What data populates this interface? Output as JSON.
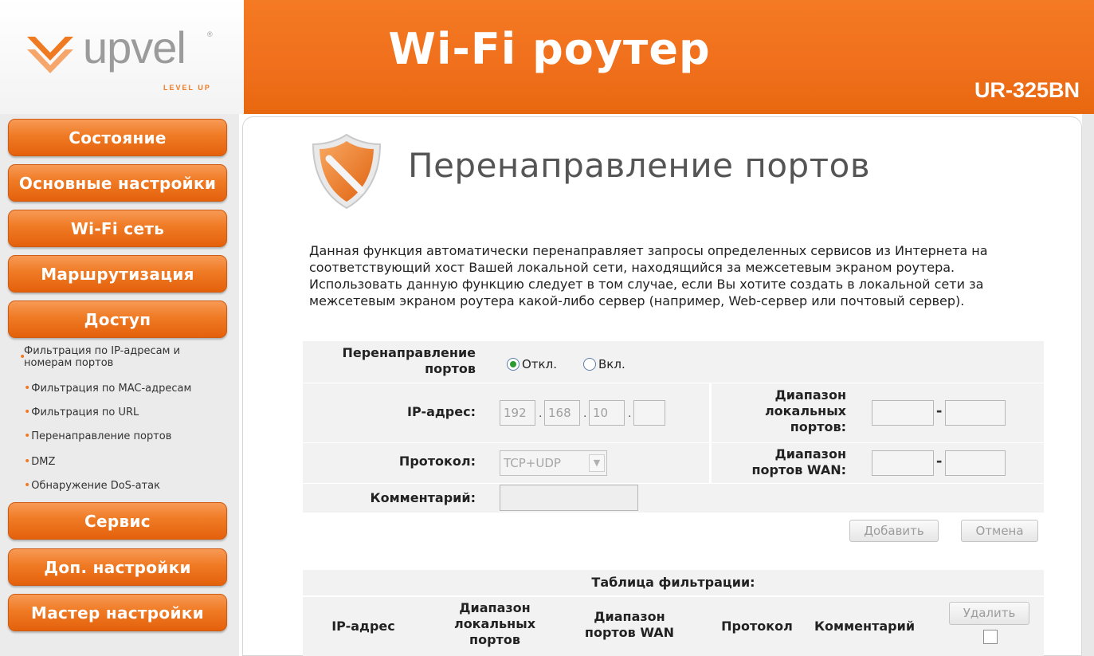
{
  "header": {
    "logo_word": "upvel",
    "logo_tagline": "LEVEL UP",
    "logo_registered": "®",
    "title": "Wi-Fi роутер",
    "model": "UR-325BN",
    "brand_color": "#f07a21"
  },
  "sidebar": {
    "buttons": [
      {
        "label": "Состояние"
      },
      {
        "label": "Основные настройки"
      },
      {
        "label": "Wi-Fi сеть"
      },
      {
        "label": "Маршрутизация"
      },
      {
        "label": "Доступ"
      },
      {
        "label": "Сервис"
      },
      {
        "label": "Доп. настройки"
      },
      {
        "label": "Мастер настройки"
      }
    ],
    "sub_items": [
      {
        "label": "Фильтрация по IP-адресам и номерам портов"
      },
      {
        "label": "Фильтрация по MAC-адресам"
      },
      {
        "label": "Фильтрация по URL"
      },
      {
        "label": "Перенаправление портов"
      },
      {
        "label": "DMZ"
      },
      {
        "label": "Обнаружение DoS-атак"
      }
    ]
  },
  "page": {
    "title": "Перенаправление портов",
    "icon": "shield-icon",
    "description": "Данная функция автоматически перенаправляет запросы определенных сервисов из Интернета на соответствующий хост Вашей локальной сети, находящийся за межсетевым экраном роутера. Использовать данную функцию следует в том случае, если Вы хотите создать в локальной сети за межсетевым экраном роутера какой-либо сервер (например, Web-сервер или почтовый сервер)."
  },
  "form": {
    "forwarding_label": "Перенаправление портов",
    "forwarding_off": "Откл.",
    "forwarding_on": "Вкл.",
    "forwarding_selected": "Откл.",
    "ip_label": "IP-адрес:",
    "ip_octets": [
      "192",
      "168",
      "10",
      ""
    ],
    "local_ports_label": "Диапазон локальных портов:",
    "protocol_label": "Протокол:",
    "protocol_value": "TCP+UDP",
    "wan_ports_label": "Диапазон портов WAN:",
    "comment_label": "Комментарий:",
    "add_button": "Добавить",
    "cancel_button": "Отмена"
  },
  "table": {
    "title": "Таблица фильтрации:",
    "columns": [
      "IP-адрес",
      "Диапазон локальных портов",
      "Диапазон портов WAN",
      "Протокол",
      "Комментарий"
    ],
    "delete_button": "Удалить"
  }
}
